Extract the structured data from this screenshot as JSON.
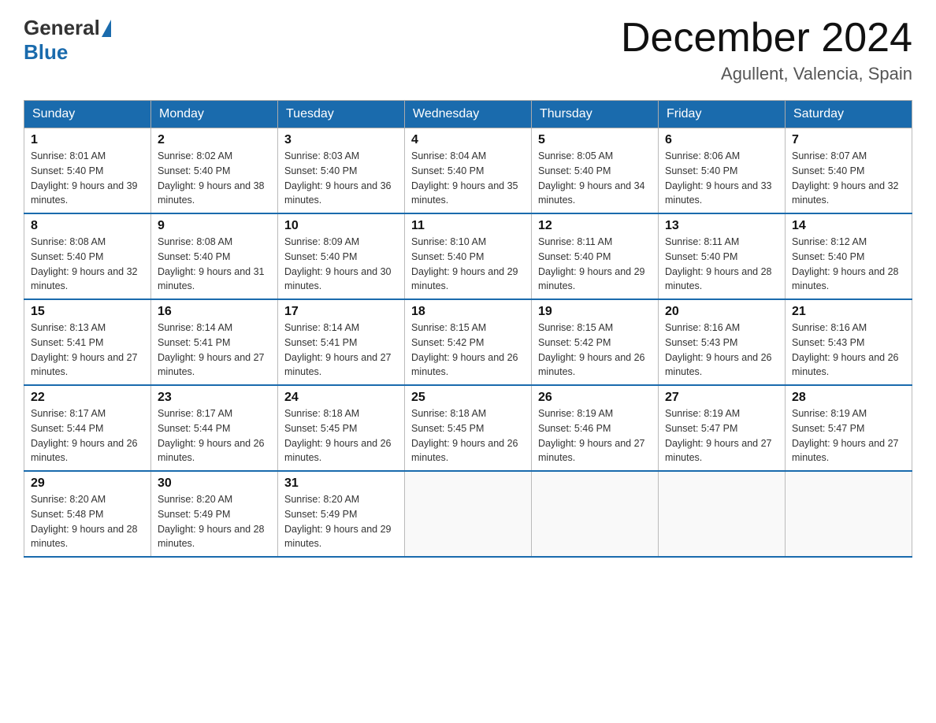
{
  "header": {
    "logo_general": "General",
    "logo_blue": "Blue",
    "month_title": "December 2024",
    "location": "Agullent, Valencia, Spain"
  },
  "days_of_week": [
    "Sunday",
    "Monday",
    "Tuesday",
    "Wednesday",
    "Thursday",
    "Friday",
    "Saturday"
  ],
  "weeks": [
    [
      {
        "day": "1",
        "sunrise": "8:01 AM",
        "sunset": "5:40 PM",
        "daylight": "9 hours and 39 minutes."
      },
      {
        "day": "2",
        "sunrise": "8:02 AM",
        "sunset": "5:40 PM",
        "daylight": "9 hours and 38 minutes."
      },
      {
        "day": "3",
        "sunrise": "8:03 AM",
        "sunset": "5:40 PM",
        "daylight": "9 hours and 36 minutes."
      },
      {
        "day": "4",
        "sunrise": "8:04 AM",
        "sunset": "5:40 PM",
        "daylight": "9 hours and 35 minutes."
      },
      {
        "day": "5",
        "sunrise": "8:05 AM",
        "sunset": "5:40 PM",
        "daylight": "9 hours and 34 minutes."
      },
      {
        "day": "6",
        "sunrise": "8:06 AM",
        "sunset": "5:40 PM",
        "daylight": "9 hours and 33 minutes."
      },
      {
        "day": "7",
        "sunrise": "8:07 AM",
        "sunset": "5:40 PM",
        "daylight": "9 hours and 32 minutes."
      }
    ],
    [
      {
        "day": "8",
        "sunrise": "8:08 AM",
        "sunset": "5:40 PM",
        "daylight": "9 hours and 32 minutes."
      },
      {
        "day": "9",
        "sunrise": "8:08 AM",
        "sunset": "5:40 PM",
        "daylight": "9 hours and 31 minutes."
      },
      {
        "day": "10",
        "sunrise": "8:09 AM",
        "sunset": "5:40 PM",
        "daylight": "9 hours and 30 minutes."
      },
      {
        "day": "11",
        "sunrise": "8:10 AM",
        "sunset": "5:40 PM",
        "daylight": "9 hours and 29 minutes."
      },
      {
        "day": "12",
        "sunrise": "8:11 AM",
        "sunset": "5:40 PM",
        "daylight": "9 hours and 29 minutes."
      },
      {
        "day": "13",
        "sunrise": "8:11 AM",
        "sunset": "5:40 PM",
        "daylight": "9 hours and 28 minutes."
      },
      {
        "day": "14",
        "sunrise": "8:12 AM",
        "sunset": "5:40 PM",
        "daylight": "9 hours and 28 minutes."
      }
    ],
    [
      {
        "day": "15",
        "sunrise": "8:13 AM",
        "sunset": "5:41 PM",
        "daylight": "9 hours and 27 minutes."
      },
      {
        "day": "16",
        "sunrise": "8:14 AM",
        "sunset": "5:41 PM",
        "daylight": "9 hours and 27 minutes."
      },
      {
        "day": "17",
        "sunrise": "8:14 AM",
        "sunset": "5:41 PM",
        "daylight": "9 hours and 27 minutes."
      },
      {
        "day": "18",
        "sunrise": "8:15 AM",
        "sunset": "5:42 PM",
        "daylight": "9 hours and 26 minutes."
      },
      {
        "day": "19",
        "sunrise": "8:15 AM",
        "sunset": "5:42 PM",
        "daylight": "9 hours and 26 minutes."
      },
      {
        "day": "20",
        "sunrise": "8:16 AM",
        "sunset": "5:43 PM",
        "daylight": "9 hours and 26 minutes."
      },
      {
        "day": "21",
        "sunrise": "8:16 AM",
        "sunset": "5:43 PM",
        "daylight": "9 hours and 26 minutes."
      }
    ],
    [
      {
        "day": "22",
        "sunrise": "8:17 AM",
        "sunset": "5:44 PM",
        "daylight": "9 hours and 26 minutes."
      },
      {
        "day": "23",
        "sunrise": "8:17 AM",
        "sunset": "5:44 PM",
        "daylight": "9 hours and 26 minutes."
      },
      {
        "day": "24",
        "sunrise": "8:18 AM",
        "sunset": "5:45 PM",
        "daylight": "9 hours and 26 minutes."
      },
      {
        "day": "25",
        "sunrise": "8:18 AM",
        "sunset": "5:45 PM",
        "daylight": "9 hours and 26 minutes."
      },
      {
        "day": "26",
        "sunrise": "8:19 AM",
        "sunset": "5:46 PM",
        "daylight": "9 hours and 27 minutes."
      },
      {
        "day": "27",
        "sunrise": "8:19 AM",
        "sunset": "5:47 PM",
        "daylight": "9 hours and 27 minutes."
      },
      {
        "day": "28",
        "sunrise": "8:19 AM",
        "sunset": "5:47 PM",
        "daylight": "9 hours and 27 minutes."
      }
    ],
    [
      {
        "day": "29",
        "sunrise": "8:20 AM",
        "sunset": "5:48 PM",
        "daylight": "9 hours and 28 minutes."
      },
      {
        "day": "30",
        "sunrise": "8:20 AM",
        "sunset": "5:49 PM",
        "daylight": "9 hours and 28 minutes."
      },
      {
        "day": "31",
        "sunrise": "8:20 AM",
        "sunset": "5:49 PM",
        "daylight": "9 hours and 29 minutes."
      },
      null,
      null,
      null,
      null
    ]
  ]
}
